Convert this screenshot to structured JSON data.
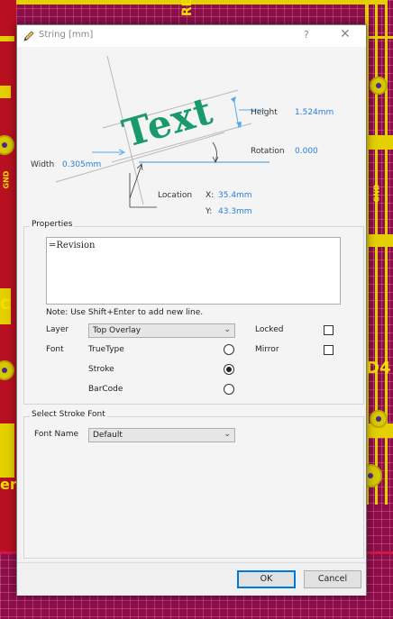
{
  "window": {
    "title": "String  [mm]",
    "help_label": "?",
    "close_label": "✕",
    "icon": "pen-icon"
  },
  "preview": {
    "sample_text": "Text",
    "height_label": "Height",
    "height_value": "1.524mm",
    "rotation_label": "Rotation",
    "rotation_value": "0.000",
    "width_label": "Width",
    "width_value": "0.305mm",
    "location_label": "Location",
    "x_label": "X:",
    "x_value": "35.4mm",
    "y_label": "Y:",
    "y_value": "43.3mm"
  },
  "properties": {
    "group_title": "Properties",
    "text_value": "=Revision",
    "note": "Note: Use Shift+Enter to add new line.",
    "layer_label": "Layer",
    "layer_value": "Top Overlay",
    "locked_label": "Locked",
    "locked_checked": false,
    "font_label": "Font",
    "mirror_label": "Mirror",
    "mirror_checked": false,
    "font_options": [
      {
        "label": "TrueType",
        "selected": false
      },
      {
        "label": "Stroke",
        "selected": true
      },
      {
        "label": "BarCode",
        "selected": false
      }
    ]
  },
  "stroke_font": {
    "group_title": "Select Stroke Font",
    "font_name_label": "Font Name",
    "font_name_value": "Default"
  },
  "buttons": {
    "ok": "OK",
    "cancel": "Cancel"
  },
  "background": {
    "silk_labels": [
      "RE",
      "D4",
      "er",
      "GND",
      "GND",
      "C"
    ],
    "board_color": "#8c0f4a",
    "trace_color": "#e4d000",
    "accent_color": "#2a7ed8",
    "preview_text_color": "#1a9a6a"
  }
}
